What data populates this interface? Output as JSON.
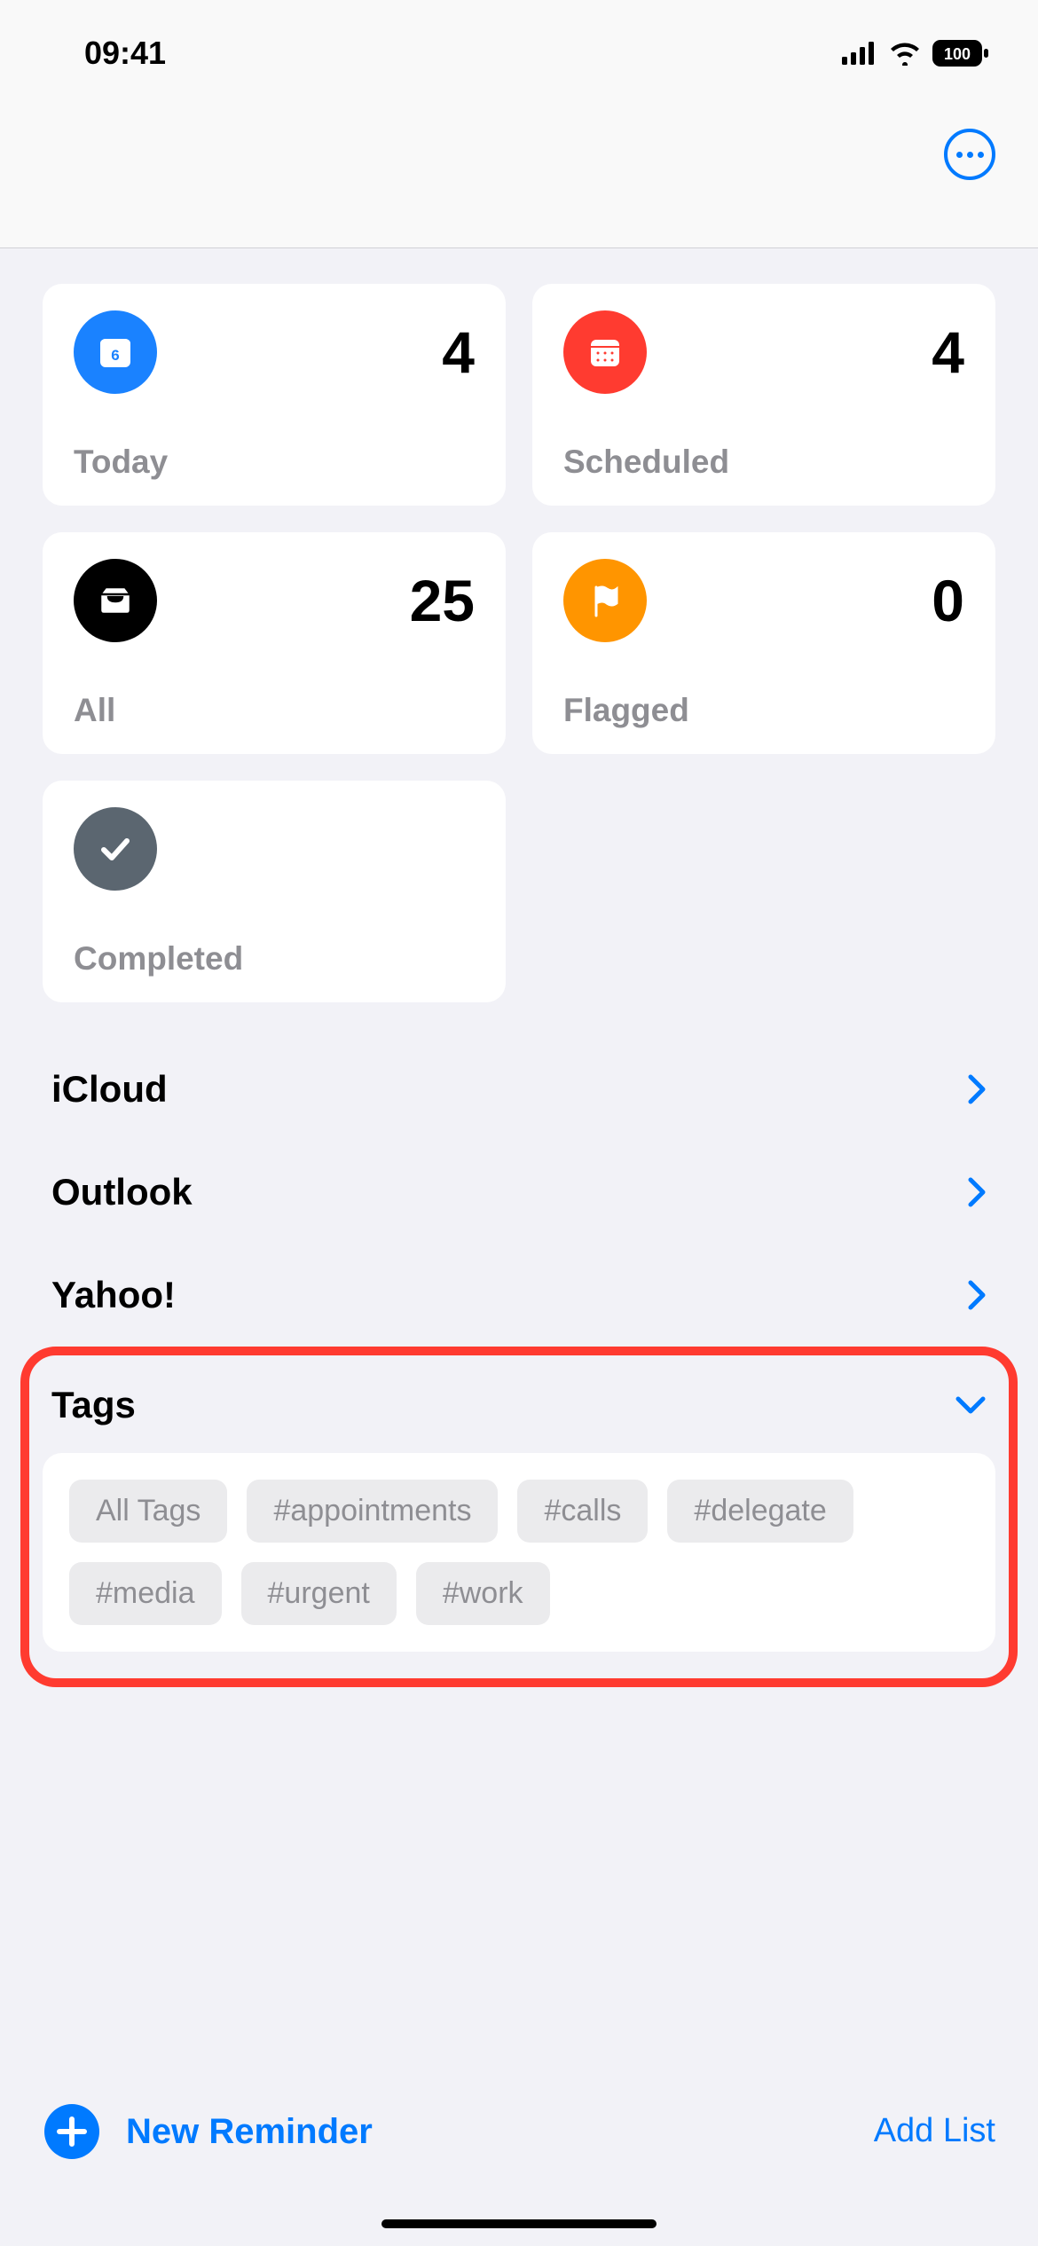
{
  "status": {
    "time": "09:41",
    "battery": "100"
  },
  "cards": {
    "today": {
      "label": "Today",
      "count": "4"
    },
    "scheduled": {
      "label": "Scheduled",
      "count": "4"
    },
    "all": {
      "label": "All",
      "count": "25"
    },
    "flagged": {
      "label": "Flagged",
      "count": "0"
    },
    "completed": {
      "label": "Completed",
      "count": ""
    }
  },
  "accounts": {
    "icloud": "iCloud",
    "outlook": "Outlook",
    "yahoo": "Yahoo!"
  },
  "tags": {
    "title": "Tags",
    "items": {
      "all": "All Tags",
      "appointments": "#appointments",
      "calls": "#calls",
      "delegate": "#delegate",
      "media": "#media",
      "urgent": "#urgent",
      "work": "#work"
    }
  },
  "bottom": {
    "new_reminder": "New Reminder",
    "add_list": "Add List"
  }
}
